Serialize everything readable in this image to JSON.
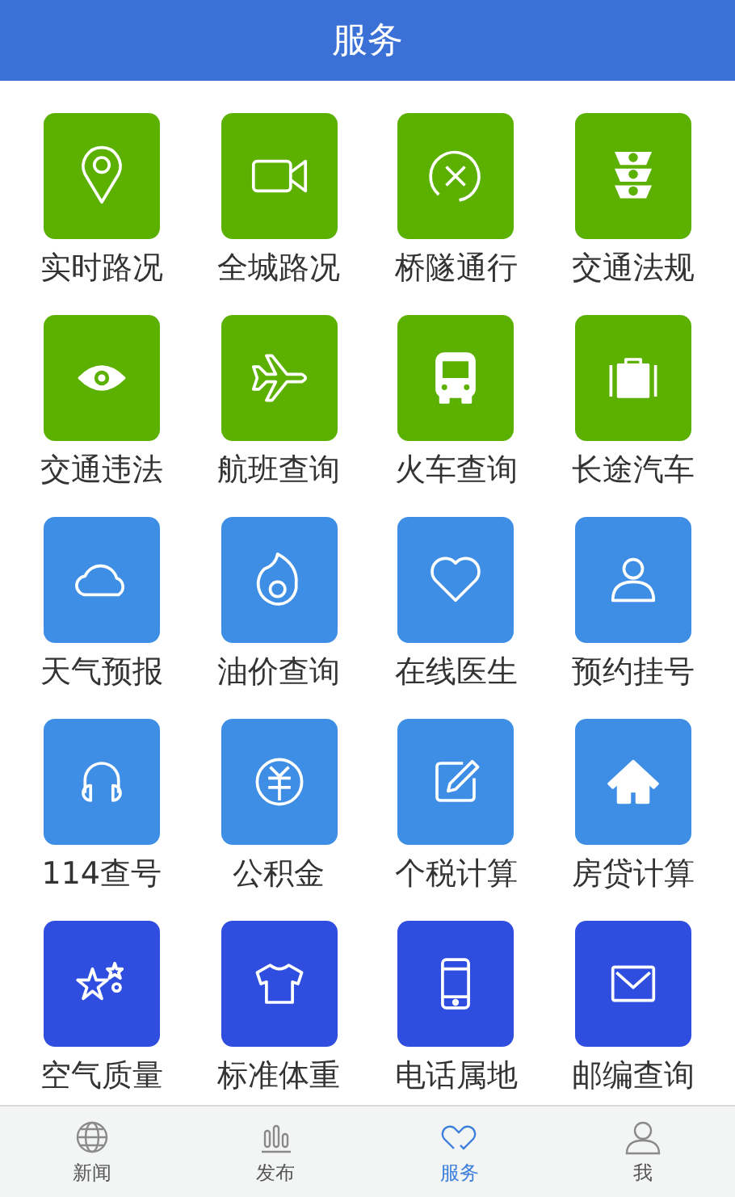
{
  "header": {
    "title": "服务"
  },
  "services": [
    {
      "label": "实时路况",
      "color": "#5bb000"
    },
    {
      "label": "全城路况",
      "color": "#5bb000"
    },
    {
      "label": "桥隧通行",
      "color": "#5bb000"
    },
    {
      "label": "交通法规",
      "color": "#5bb000"
    },
    {
      "label": "交通违法",
      "color": "#5bb000"
    },
    {
      "label": "航班查询",
      "color": "#5bb000"
    },
    {
      "label": "火车查询",
      "color": "#5bb000"
    },
    {
      "label": "长途汽车",
      "color": "#5bb000"
    },
    {
      "label": "天气预报",
      "color": "#3f8ee6"
    },
    {
      "label": "油价查询",
      "color": "#3f8ee6"
    },
    {
      "label": "在线医生",
      "color": "#3f8ee6"
    },
    {
      "label": "预约挂号",
      "color": "#3f8ee6"
    },
    {
      "label": "114查号",
      "color": "#3f8ee6"
    },
    {
      "label": "公积金",
      "color": "#3f8ee6"
    },
    {
      "label": "个税计算",
      "color": "#3f8ee6"
    },
    {
      "label": "房贷计算",
      "color": "#3f8ee6"
    },
    {
      "label": "空气质量",
      "color": "#2f4ee0"
    },
    {
      "label": "标准体重",
      "color": "#2f4ee0"
    },
    {
      "label": "电话属地",
      "color": "#2f4ee0"
    },
    {
      "label": "邮编查询",
      "color": "#2f4ee0"
    }
  ],
  "tab_bar": [
    {
      "label": "新闻",
      "selected": false
    },
    {
      "label": "发布",
      "selected": false
    },
    {
      "label": "服务",
      "selected": true
    },
    {
      "label": "我",
      "selected": false
    }
  ]
}
